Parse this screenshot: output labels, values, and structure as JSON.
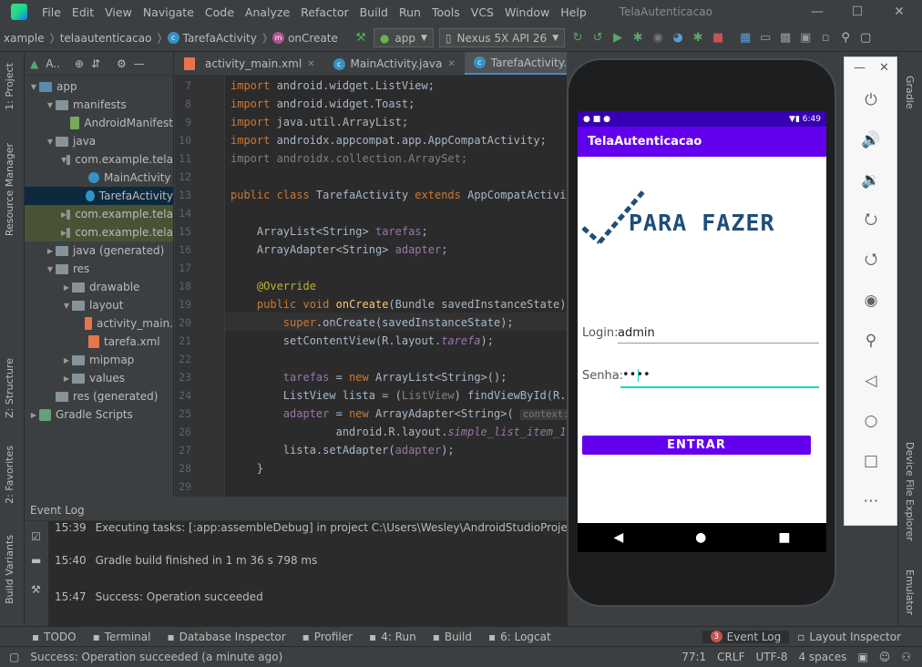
{
  "menu": [
    "File",
    "Edit",
    "View",
    "Navigate",
    "Code",
    "Analyze",
    "Refactor",
    "Build",
    "Run",
    "Tools",
    "VCS",
    "Window",
    "Help"
  ],
  "window_title": "TelaAutenticacao",
  "breadcrumbs": [
    "xample",
    "telaautenticacao",
    "TarefaActivity",
    "onCreate"
  ],
  "run_config": "app",
  "device": "Nexus 5X API 26",
  "project_header": "A..",
  "tree": [
    {
      "label": "app",
      "indent": 0,
      "arrow": "▼",
      "icon": "fold blue"
    },
    {
      "label": "manifests",
      "indent": 1,
      "arrow": "▼",
      "icon": "fold"
    },
    {
      "label": "AndroidManifest",
      "indent": 2,
      "arrow": "",
      "icon": "file-m"
    },
    {
      "label": "java",
      "indent": 1,
      "arrow": "▼",
      "icon": "fold"
    },
    {
      "label": "com.example.tela",
      "indent": 2,
      "arrow": "▼",
      "icon": "fold"
    },
    {
      "label": "MainActivity",
      "indent": 3,
      "arrow": "",
      "icon": "file-c"
    },
    {
      "label": "TarefaActivity",
      "indent": 3,
      "arrow": "",
      "icon": "file-c",
      "state": "sel"
    },
    {
      "label": "com.example.tela",
      "indent": 2,
      "arrow": "▶",
      "icon": "fold",
      "state": "hl"
    },
    {
      "label": "com.example.tela",
      "indent": 2,
      "arrow": "▶",
      "icon": "fold",
      "state": "hl"
    },
    {
      "label": "java (generated)",
      "indent": 1,
      "arrow": "▶",
      "icon": "fold"
    },
    {
      "label": "res",
      "indent": 1,
      "arrow": "▼",
      "icon": "fold"
    },
    {
      "label": "drawable",
      "indent": 2,
      "arrow": "▶",
      "icon": "fold"
    },
    {
      "label": "layout",
      "indent": 2,
      "arrow": "▼",
      "icon": "fold"
    },
    {
      "label": "activity_main.",
      "indent": 3,
      "arrow": "",
      "icon": "file-x"
    },
    {
      "label": "tarefa.xml",
      "indent": 3,
      "arrow": "",
      "icon": "file-x"
    },
    {
      "label": "mipmap",
      "indent": 2,
      "arrow": "▶",
      "icon": "fold"
    },
    {
      "label": "values",
      "indent": 2,
      "arrow": "▶",
      "icon": "fold"
    },
    {
      "label": "res (generated)",
      "indent": 1,
      "arrow": "",
      "icon": "fold"
    },
    {
      "label": "Gradle Scripts",
      "indent": 0,
      "arrow": "▶",
      "icon": "gr-ic"
    }
  ],
  "tabs": [
    {
      "label": "activity_main.xml",
      "active": false
    },
    {
      "label": "MainActivity.java",
      "active": false
    },
    {
      "label": "TarefaActivity.java",
      "active": true
    }
  ],
  "code_lines": [
    {
      "n": "7",
      "html": "<span class=\"kw\">import</span> android.widget.ListView;"
    },
    {
      "n": "8",
      "html": "<span class=\"kw\">import</span> android.widget.Toast;"
    },
    {
      "n": "9",
      "html": "<span class=\"kw\">import</span> java.util.ArrayList;"
    },
    {
      "n": "10",
      "html": "<span class=\"kw\">import</span> androidx.appcompat.app.AppCompatActivity;"
    },
    {
      "n": "11",
      "html": "<span class=\"gray\">import androidx.collection.ArraySet;</span>"
    },
    {
      "n": "12",
      "html": ""
    },
    {
      "n": "13",
      "html": "<span class=\"kw\">public class</span> TarefaActivity <span class=\"kw\">extends</span> AppCompatActivity"
    },
    {
      "n": "14",
      "html": ""
    },
    {
      "n": "15",
      "html": "    ArrayList&lt;String&gt; <span class=\"fld\">tarefas</span>;"
    },
    {
      "n": "16",
      "html": "    ArrayAdapter&lt;String&gt; <span class=\"fld\">adapter</span>;"
    },
    {
      "n": "17",
      "html": ""
    },
    {
      "n": "18",
      "html": "    <span class=\"an\">@Override</span>"
    },
    {
      "n": "19",
      "html": "    <span class=\"kw\">public void</span> <span class=\"fn\">onCreate</span>(Bundle savedInstanceState) {"
    },
    {
      "n": "20",
      "html": "        <span class=\"kw\">super</span>.onCreate(savedInstanceState);"
    },
    {
      "n": "21",
      "html": "        setContentView(R.layout.<span class=\"it\">tarefa</span>);"
    },
    {
      "n": "22",
      "html": ""
    },
    {
      "n": "23",
      "html": "        <span class=\"fld\">tarefas</span> = <span class=\"kw\">new</span> ArrayList&lt;String&gt;();"
    },
    {
      "n": "24",
      "html": "        ListView lista = (<span class=\"gray\">ListView</span>) findViewById(R.id."
    },
    {
      "n": "25",
      "html": "        <span class=\"fld\">adapter</span> = <span class=\"kw\">new</span> ArrayAdapter&lt;String&gt;( <span class=\"hint\">context:</span> <span class=\"kw\">th</span>"
    },
    {
      "n": "26",
      "html": "                android.R.layout.<span class=\"it\">simple_list_item_1</span>,"
    },
    {
      "n": "27",
      "html": "        lista.setAdapter(<span class=\"fld\">adapter</span>);"
    },
    {
      "n": "28",
      "html": "    }"
    },
    {
      "n": "29",
      "html": ""
    }
  ],
  "event_log": {
    "title": "Event Log",
    "lines": [
      {
        "time": "15:39",
        "text": "Executing tasks: [:app:assembleDebug] in project C:\\Users\\Wesley\\AndroidStudioProjects\\TelaAuten"
      },
      {
        "time": "15:40",
        "text": "Gradle build finished in 1 m 36 s 798 ms"
      },
      {
        "time": "15:47",
        "text": "Success: Operation succeeded"
      }
    ]
  },
  "phone": {
    "status_time": "6:49",
    "app_title": "TelaAutenticacao",
    "logo_text": "PARA FAZER",
    "login_label": "Login:",
    "login_value": "admin",
    "senha_label": "Senha:",
    "senha_value": "••••",
    "button": "ENTRAR"
  },
  "left_strip": [
    "1: Project",
    "Resource Manager",
    "Z: Structure",
    "2: Favorites",
    "Build Variants"
  ],
  "right_strip": [
    "Gradle",
    "Device File Explorer",
    "Emulator"
  ],
  "bottom_tools": [
    {
      "label": "TODO"
    },
    {
      "label": "Terminal"
    },
    {
      "label": "Database Inspector"
    },
    {
      "label": "Profiler"
    },
    {
      "label": "4: Run"
    },
    {
      "label": "Build"
    },
    {
      "label": "6: Logcat"
    }
  ],
  "bottom_right_tools": [
    {
      "label": "Event Log",
      "badge": "3",
      "active": true
    },
    {
      "label": "Layout Inspector"
    }
  ],
  "status": {
    "message": "Success: Operation succeeded (a minute ago)",
    "position": "77:1",
    "line_sep": "CRLF",
    "encoding": "UTF-8",
    "indent": "4 spaces"
  },
  "colors": {
    "accent": "#6200ee",
    "status_dark": "#3700b3",
    "ide_bg": "#3c3f41",
    "editor_bg": "#2b2b2b"
  }
}
